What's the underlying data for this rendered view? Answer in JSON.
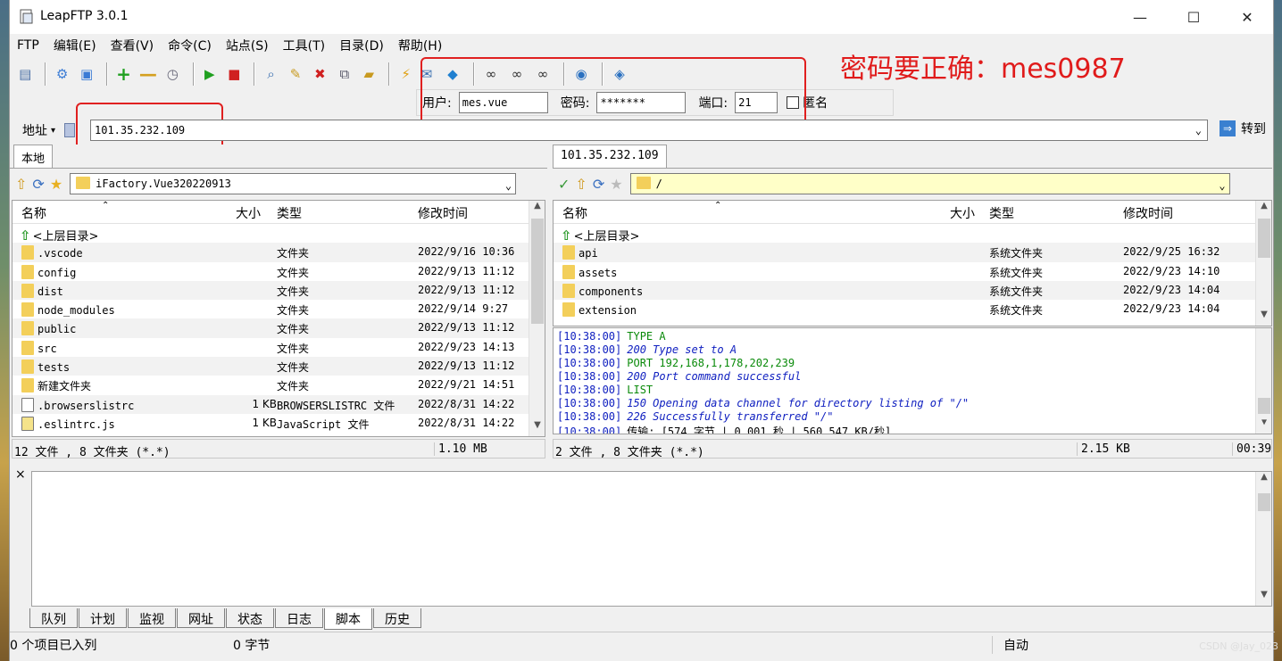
{
  "window": {
    "title": "LeapFTP 3.0.1",
    "minimize": "—",
    "maximize": "☐",
    "close": "✕"
  },
  "menu": [
    "FTP",
    "编辑(E)",
    "查看(V)",
    "命令(C)",
    "站点(S)",
    "工具(T)",
    "目录(D)",
    "帮助(H)"
  ],
  "login": {
    "user_label": "用户:",
    "user_value": "mes.vue",
    "pass_label": "密码:",
    "pass_value": "*******",
    "port_label": "端口:",
    "port_value": "21",
    "anon_label": "匿名"
  },
  "annotation": "密码要正确：mes0987",
  "address": {
    "label": "地址",
    "value": "101.35.232.109",
    "goto_label": "转到"
  },
  "local": {
    "tab": "本地",
    "path": "iFactory.Vue320220913",
    "columns": [
      "名称",
      "大小",
      "类型",
      "修改时间"
    ],
    "parent": "<上层目录>",
    "rows": [
      {
        "name": ".vscode",
        "size": "",
        "type": "文件夹",
        "modified": "2022/9/16 10:36",
        "icon": "folder-icon"
      },
      {
        "name": "config",
        "size": "",
        "type": "文件夹",
        "modified": "2022/9/13 11:12",
        "icon": "folder-icon"
      },
      {
        "name": "dist",
        "size": "",
        "type": "文件夹",
        "modified": "2022/9/13 11:12",
        "icon": "folder-icon"
      },
      {
        "name": "node_modules",
        "size": "",
        "type": "文件夹",
        "modified": "2022/9/14 9:27",
        "icon": "folder-icon"
      },
      {
        "name": "public",
        "size": "",
        "type": "文件夹",
        "modified": "2022/9/13 11:12",
        "icon": "folder-icon"
      },
      {
        "name": "src",
        "size": "",
        "type": "文件夹",
        "modified": "2022/9/23 14:13",
        "icon": "folder-icon"
      },
      {
        "name": "tests",
        "size": "",
        "type": "文件夹",
        "modified": "2022/9/13 11:12",
        "icon": "folder-icon"
      },
      {
        "name": "新建文件夹",
        "size": "",
        "type": "文件夹",
        "modified": "2022/9/21 14:51",
        "icon": "folder-icon"
      },
      {
        "name": ".browserslistrc",
        "size": "1 KB",
        "type": "BROWSERSLISTRC 文件",
        "modified": "2022/8/31 14:22",
        "icon": "file-icon"
      },
      {
        "name": ".eslintrc.js",
        "size": "1 KB",
        "type": "JavaScript 文件",
        "modified": "2022/8/31 14:22",
        "icon": "js-file-icon"
      }
    ],
    "status_count": "12 文件 , 8 文件夹  (*.*)",
    "status_size": "1.10 MB"
  },
  "remote": {
    "tab": "101.35.232.109",
    "path": "/",
    "columns": [
      "名称",
      "大小",
      "类型",
      "修改时间"
    ],
    "parent": "<上层目录>",
    "rows": [
      {
        "name": "api",
        "size": "",
        "type": "系统文件夹",
        "modified": "2022/9/25 16:32",
        "icon": "folder-icon"
      },
      {
        "name": "assets",
        "size": "",
        "type": "系统文件夹",
        "modified": "2022/9/23 14:10",
        "icon": "folder-icon"
      },
      {
        "name": "components",
        "size": "",
        "type": "系统文件夹",
        "modified": "2022/9/23 14:04",
        "icon": "folder-icon"
      },
      {
        "name": "extension",
        "size": "",
        "type": "系统文件夹",
        "modified": "2022/9/23 14:04",
        "icon": "folder-icon"
      }
    ],
    "log": [
      {
        "time": "[10:38:00]",
        "text": "TYPE A",
        "color": "#0a8a0a"
      },
      {
        "time": "[10:38:00]",
        "text": "200 Type set to A",
        "color": "#1020c0"
      },
      {
        "time": "[10:38:00]",
        "text": "PORT 192,168,1,178,202,239",
        "color": "#0a8a0a"
      },
      {
        "time": "[10:38:00]",
        "text": "200 Port command successful",
        "color": "#1020c0"
      },
      {
        "time": "[10:38:00]",
        "text": "LIST",
        "color": "#0a8a0a"
      },
      {
        "time": "[10:38:00]",
        "text": "150 Opening data channel for directory listing of \"/\"",
        "color": "#1020c0"
      },
      {
        "time": "[10:38:00]",
        "text": "226 Successfully transferred \"/\"",
        "color": "#1020c0"
      },
      {
        "time": "[10:38:00]",
        "text": "传输: [574 字节 | 0.001 秒 | 560.547 KB/秒]",
        "color": "#000000"
      }
    ],
    "status_count": "2 文件 , 8 文件夹  (*.*)",
    "status_size": "2.15 KB",
    "status_time": "00:39"
  },
  "bottom_tabs": [
    "队列",
    "计划",
    "监视",
    "网址",
    "状态",
    "日志",
    "脚本",
    "历史"
  ],
  "active_bottom_tab": "脚本",
  "bottom_status": {
    "items": "0 个项目已入列",
    "bytes": "0 字节",
    "mode": "自动"
  },
  "watermark": "CSDN @Jay_023",
  "close_queue": "×"
}
